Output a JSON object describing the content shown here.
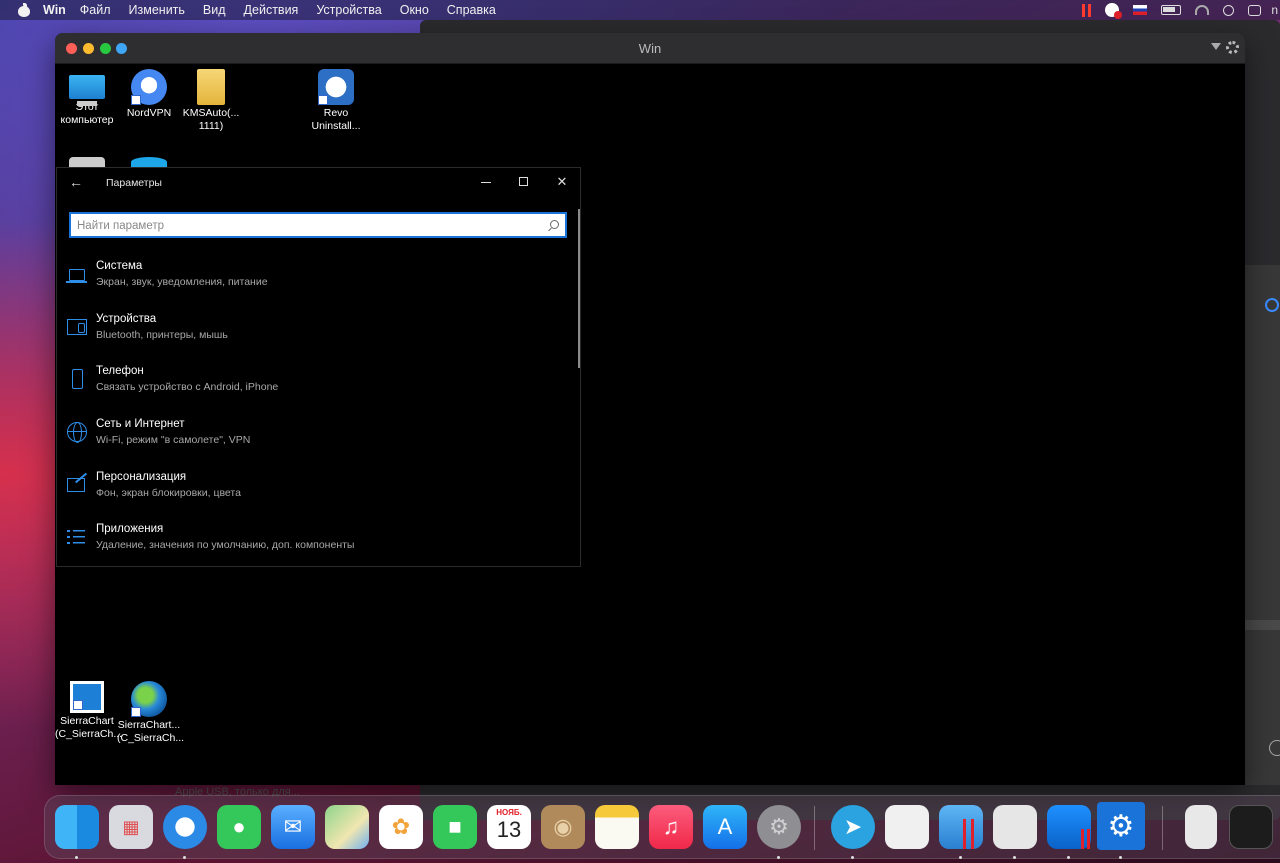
{
  "menubar": {
    "app_name": "Win",
    "items": [
      "Файл",
      "Изменить",
      "Вид",
      "Действия",
      "Устройства",
      "Окно",
      "Справка"
    ],
    "user_initials": "n"
  },
  "vm_window": {
    "title": "Win"
  },
  "desktop_icons": [
    {
      "label": "Этот компьютер",
      "icon": "this-pc-icon"
    },
    {
      "label": "NordVPN",
      "icon": "nordvpn-icon"
    },
    {
      "label": "KMSAuto(... 1111)",
      "icon": "folder-icon"
    },
    {
      "label": "Revo Uninstall...",
      "icon": "revo-icon"
    },
    {
      "label": "SierraChart (C_SierraCh...",
      "icon": "sierrachart-icon"
    },
    {
      "label": "SierraChart... (C_SierraCh...",
      "icon": "globe-icon"
    }
  ],
  "settings": {
    "title": "Параметры",
    "search_placeholder": "Найти параметр",
    "categories": [
      {
        "name": "Система",
        "desc": "Экран, звук, уведомления, питание",
        "icon": "laptop-icon"
      },
      {
        "name": "Устройства",
        "desc": "Bluetooth, принтеры, мышь",
        "icon": "devices-icon"
      },
      {
        "name": "Телефон",
        "desc": "Связать устройство с Android, iPhone",
        "icon": "phone-icon"
      },
      {
        "name": "Сеть и Интернет",
        "desc": "Wi-Fi, режим \"в самолете\", VPN",
        "icon": "globe-icon"
      },
      {
        "name": "Персонализация",
        "desc": "Фон, экран блокировки, цвета",
        "icon": "personalization-icon"
      },
      {
        "name": "Приложения",
        "desc": "Удаление, значения по умолчанию, доп. компоненты",
        "icon": "apps-icon"
      }
    ]
  },
  "dock": {
    "calendar_month": "НОЯБ.",
    "calendar_day": "13",
    "apps": [
      "Finder",
      "Launchpad",
      "Safari",
      "Messages",
      "Mail",
      "Maps",
      "Photos",
      "FaceTime",
      "Calendar",
      "Contacts",
      "Notes",
      "Music",
      "App Store",
      "System Preferences",
      "Telegram",
      "Parallels",
      "Windows VM",
      "Disk Utility",
      "Windows",
      "Settings",
      "Documents",
      "Terminal"
    ]
  },
  "background_window": {
    "partial_text": "Apple USB, только для..."
  },
  "colors": {
    "accent_blue": "#2f8ee8",
    "search_border": "#1a73d9",
    "settings_bg": "#000000",
    "close_red": "#ff5f57",
    "minimize_yellow": "#febc2e",
    "maximize_green": "#28c840"
  }
}
